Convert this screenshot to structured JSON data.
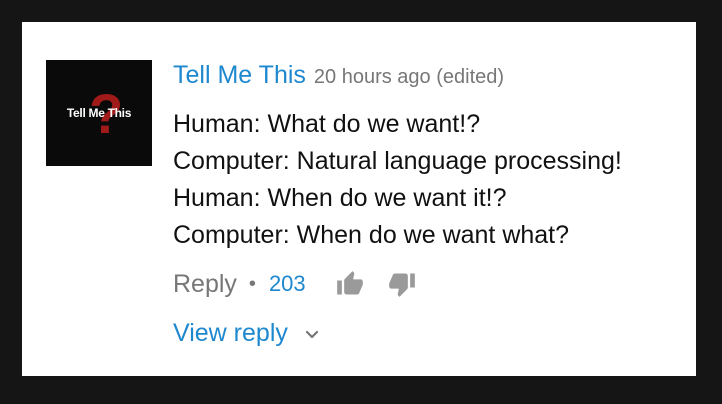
{
  "comment": {
    "avatar_text": "Tell Me This",
    "author": "Tell Me This",
    "timestamp": "20 hours ago (edited)",
    "lines": [
      "Human: What do we want!?",
      "Computer: Natural language processing!",
      "Human: When do we want it!?",
      "Computer: When do we want what?"
    ],
    "actions": {
      "reply_label": "Reply",
      "separator": "•",
      "like_count": "203",
      "like_icon": "thumbs-up-icon",
      "dislike_icon": "thumbs-down-icon"
    },
    "view_replies_label": "View reply",
    "view_replies_icon": "chevron-down-icon"
  },
  "colors": {
    "link_blue": "#1e88cf",
    "muted_gray": "#777777",
    "text": "#111111",
    "frame": "#151515",
    "card": "#ffffff",
    "avatar_bg": "#0a0a0a",
    "avatar_accent": "#a01a1a"
  }
}
